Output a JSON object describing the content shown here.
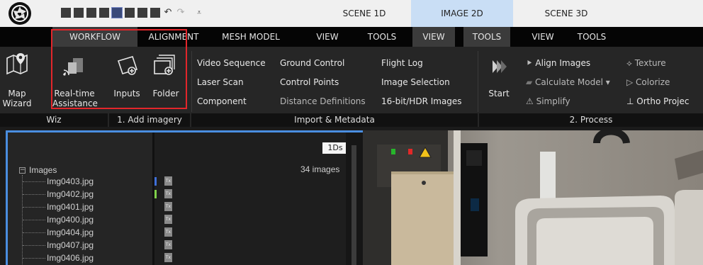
{
  "titlebar": {
    "contexts": [
      {
        "label": "SCENE 1D"
      },
      {
        "label": "IMAGE 2D"
      },
      {
        "label": "SCENE 3D"
      }
    ]
  },
  "tabs": [
    {
      "label": "WORKFLOW"
    },
    {
      "label": "ALIGNMENT"
    },
    {
      "label": "MESH MODEL"
    },
    {
      "label": "VIEW"
    },
    {
      "label": "TOOLS"
    },
    {
      "label": "VIEW"
    },
    {
      "label": "TOOLS"
    },
    {
      "label": "VIEW"
    },
    {
      "label": "TOOLS"
    }
  ],
  "ribbon": {
    "map_wizard": {
      "line1": "Map",
      "line2": "Wizard"
    },
    "realtime": {
      "line1": "Real-time",
      "line2": "Assistance"
    },
    "inputs": "Inputs",
    "folder": "Folder",
    "import": {
      "video_sequence": "Video Sequence",
      "laser_scan": "Laser Scan",
      "component": "Component",
      "ground_control": "Ground Control",
      "control_points": "Control Points",
      "distance_definitions": "Distance Definitions",
      "flight_log": "Flight Log",
      "image_selection": "Image Selection",
      "hdr_images": "16-bit/HDR Images"
    },
    "process": {
      "start": "Start",
      "align_images": "Align Images",
      "calculate_model": "Calculate Model",
      "simplify": "Simplify",
      "texture": "Texture",
      "colorize": "Colorize",
      "ortho": "Ortho Projec"
    },
    "groups": {
      "wiz": "Wiz",
      "add_imagery": "1. Add imagery",
      "import_metadata": "Import & Metadata",
      "process": "2. Process"
    }
  },
  "panel": {
    "tree_root": "Images",
    "badge": "1Ds",
    "count": "34 images",
    "files": [
      {
        "name": "Img0403.jpg",
        "mark": "#3f6fd8"
      },
      {
        "name": "Img0402.jpg",
        "mark": "#7fd14a"
      },
      {
        "name": "Img0401.jpg",
        "mark": ""
      },
      {
        "name": "Img0400.jpg",
        "mark": ""
      },
      {
        "name": "Img0404.jpg",
        "mark": ""
      },
      {
        "name": "Img0407.jpg",
        "mark": ""
      },
      {
        "name": "Img0406.jpg",
        "mark": ""
      }
    ],
    "tx_label": "Tx"
  }
}
